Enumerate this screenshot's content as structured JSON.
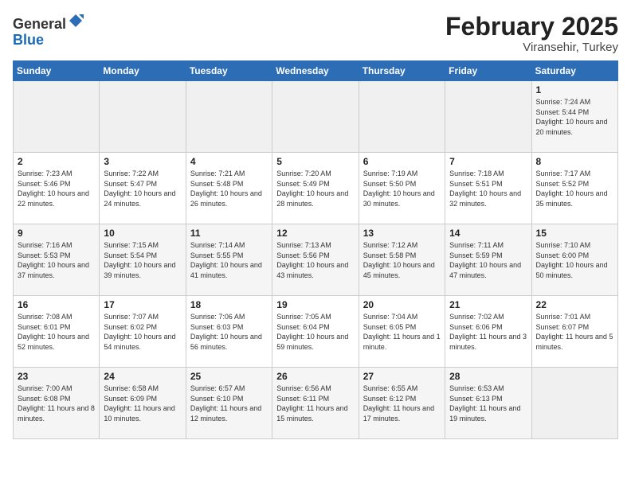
{
  "header": {
    "logo_line1": "General",
    "logo_line2": "Blue",
    "month": "February 2025",
    "location": "Viransehir, Turkey"
  },
  "weekdays": [
    "Sunday",
    "Monday",
    "Tuesday",
    "Wednesday",
    "Thursday",
    "Friday",
    "Saturday"
  ],
  "weeks": [
    [
      {
        "day": "",
        "info": ""
      },
      {
        "day": "",
        "info": ""
      },
      {
        "day": "",
        "info": ""
      },
      {
        "day": "",
        "info": ""
      },
      {
        "day": "",
        "info": ""
      },
      {
        "day": "",
        "info": ""
      },
      {
        "day": "1",
        "info": "Sunrise: 7:24 AM\nSunset: 5:44 PM\nDaylight: 10 hours and 20 minutes."
      }
    ],
    [
      {
        "day": "2",
        "info": "Sunrise: 7:23 AM\nSunset: 5:46 PM\nDaylight: 10 hours and 22 minutes."
      },
      {
        "day": "3",
        "info": "Sunrise: 7:22 AM\nSunset: 5:47 PM\nDaylight: 10 hours and 24 minutes."
      },
      {
        "day": "4",
        "info": "Sunrise: 7:21 AM\nSunset: 5:48 PM\nDaylight: 10 hours and 26 minutes."
      },
      {
        "day": "5",
        "info": "Sunrise: 7:20 AM\nSunset: 5:49 PM\nDaylight: 10 hours and 28 minutes."
      },
      {
        "day": "6",
        "info": "Sunrise: 7:19 AM\nSunset: 5:50 PM\nDaylight: 10 hours and 30 minutes."
      },
      {
        "day": "7",
        "info": "Sunrise: 7:18 AM\nSunset: 5:51 PM\nDaylight: 10 hours and 32 minutes."
      },
      {
        "day": "8",
        "info": "Sunrise: 7:17 AM\nSunset: 5:52 PM\nDaylight: 10 hours and 35 minutes."
      }
    ],
    [
      {
        "day": "9",
        "info": "Sunrise: 7:16 AM\nSunset: 5:53 PM\nDaylight: 10 hours and 37 minutes."
      },
      {
        "day": "10",
        "info": "Sunrise: 7:15 AM\nSunset: 5:54 PM\nDaylight: 10 hours and 39 minutes."
      },
      {
        "day": "11",
        "info": "Sunrise: 7:14 AM\nSunset: 5:55 PM\nDaylight: 10 hours and 41 minutes."
      },
      {
        "day": "12",
        "info": "Sunrise: 7:13 AM\nSunset: 5:56 PM\nDaylight: 10 hours and 43 minutes."
      },
      {
        "day": "13",
        "info": "Sunrise: 7:12 AM\nSunset: 5:58 PM\nDaylight: 10 hours and 45 minutes."
      },
      {
        "day": "14",
        "info": "Sunrise: 7:11 AM\nSunset: 5:59 PM\nDaylight: 10 hours and 47 minutes."
      },
      {
        "day": "15",
        "info": "Sunrise: 7:10 AM\nSunset: 6:00 PM\nDaylight: 10 hours and 50 minutes."
      }
    ],
    [
      {
        "day": "16",
        "info": "Sunrise: 7:08 AM\nSunset: 6:01 PM\nDaylight: 10 hours and 52 minutes."
      },
      {
        "day": "17",
        "info": "Sunrise: 7:07 AM\nSunset: 6:02 PM\nDaylight: 10 hours and 54 minutes."
      },
      {
        "day": "18",
        "info": "Sunrise: 7:06 AM\nSunset: 6:03 PM\nDaylight: 10 hours and 56 minutes."
      },
      {
        "day": "19",
        "info": "Sunrise: 7:05 AM\nSunset: 6:04 PM\nDaylight: 10 hours and 59 minutes."
      },
      {
        "day": "20",
        "info": "Sunrise: 7:04 AM\nSunset: 6:05 PM\nDaylight: 11 hours and 1 minute."
      },
      {
        "day": "21",
        "info": "Sunrise: 7:02 AM\nSunset: 6:06 PM\nDaylight: 11 hours and 3 minutes."
      },
      {
        "day": "22",
        "info": "Sunrise: 7:01 AM\nSunset: 6:07 PM\nDaylight: 11 hours and 5 minutes."
      }
    ],
    [
      {
        "day": "23",
        "info": "Sunrise: 7:00 AM\nSunset: 6:08 PM\nDaylight: 11 hours and 8 minutes."
      },
      {
        "day": "24",
        "info": "Sunrise: 6:58 AM\nSunset: 6:09 PM\nDaylight: 11 hours and 10 minutes."
      },
      {
        "day": "25",
        "info": "Sunrise: 6:57 AM\nSunset: 6:10 PM\nDaylight: 11 hours and 12 minutes."
      },
      {
        "day": "26",
        "info": "Sunrise: 6:56 AM\nSunset: 6:11 PM\nDaylight: 11 hours and 15 minutes."
      },
      {
        "day": "27",
        "info": "Sunrise: 6:55 AM\nSunset: 6:12 PM\nDaylight: 11 hours and 17 minutes."
      },
      {
        "day": "28",
        "info": "Sunrise: 6:53 AM\nSunset: 6:13 PM\nDaylight: 11 hours and 19 minutes."
      },
      {
        "day": "",
        "info": ""
      }
    ]
  ]
}
